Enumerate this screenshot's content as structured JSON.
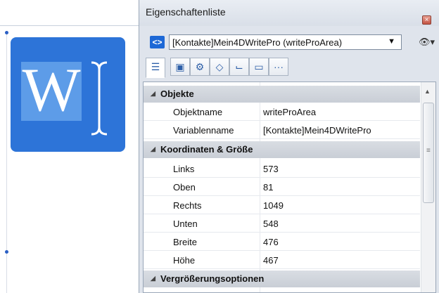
{
  "panel": {
    "title": "Eigenschaftenliste",
    "close_glyph": "×",
    "selector": {
      "value": "[Kontakte]Mein4DWritePro (writeProArea)",
      "arrow": "▼"
    },
    "nav_glyph": "<>",
    "eye_glyph": "👁▾",
    "toolbar": [
      {
        "name": "tb-list",
        "glyph": "☰",
        "active": true
      },
      {
        "name": "tb-objects",
        "glyph": "▣",
        "active": false
      },
      {
        "name": "tb-settings",
        "glyph": "⚙",
        "active": false
      },
      {
        "name": "tb-shapes",
        "glyph": "◇",
        "active": false
      },
      {
        "name": "tb-chart",
        "glyph": "⌙",
        "active": false
      },
      {
        "name": "tb-display",
        "glyph": "▭",
        "active": false
      },
      {
        "name": "tb-more",
        "glyph": "···",
        "active": false
      }
    ]
  },
  "sections": {
    "objekte": {
      "label": "Objekte",
      "rows": [
        {
          "name": "Objektname",
          "value": "writeProArea"
        },
        {
          "name": "Variablenname",
          "value": "[Kontakte]Mein4DWritePro"
        }
      ]
    },
    "koordinaten": {
      "label": "Koordinaten & Größe",
      "rows": [
        {
          "name": "Links",
          "value": "573"
        },
        {
          "name": "Oben",
          "value": "81"
        },
        {
          "name": "Rechts",
          "value": "1049"
        },
        {
          "name": "Unten",
          "value": "548"
        },
        {
          "name": "Breite",
          "value": "476"
        },
        {
          "name": "Höhe",
          "value": "467"
        }
      ]
    },
    "vergroesserung": {
      "label": "Vergrößerungsoptionen"
    }
  },
  "editor": {
    "logo_letter": "W"
  },
  "colors": {
    "accent": "#2d74d8",
    "section_bg": "#c9ced6"
  }
}
